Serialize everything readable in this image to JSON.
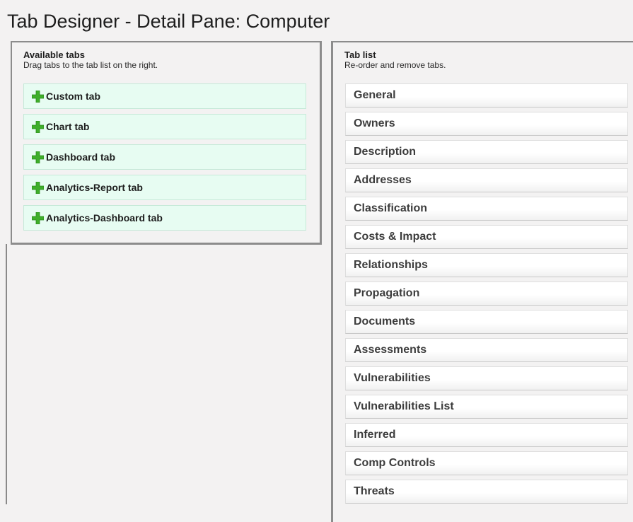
{
  "page": {
    "title": "Tab Designer - Detail Pane: Computer"
  },
  "available_tabs": {
    "heading": "Available tabs",
    "description": "Drag tabs to the tab list on the right.",
    "add_icon": "plus-icon",
    "add_icon_color": "#3fae2a",
    "items": [
      {
        "label": "Custom tab"
      },
      {
        "label": "Chart tab"
      },
      {
        "label": "Dashboard tab"
      },
      {
        "label": "Analytics-Report tab"
      },
      {
        "label": "Analytics-Dashboard tab"
      }
    ]
  },
  "tab_list": {
    "heading": "Tab list",
    "description": "Re-order and remove tabs.",
    "items": [
      {
        "label": "General"
      },
      {
        "label": "Owners"
      },
      {
        "label": "Description"
      },
      {
        "label": "Addresses"
      },
      {
        "label": "Classification"
      },
      {
        "label": "Costs & Impact"
      },
      {
        "label": "Relationships"
      },
      {
        "label": "Propagation"
      },
      {
        "label": "Documents"
      },
      {
        "label": "Assessments"
      },
      {
        "label": "Vulnerabilities"
      },
      {
        "label": "Vulnerabilities List"
      },
      {
        "label": "Inferred"
      },
      {
        "label": "Comp Controls"
      },
      {
        "label": "Threats"
      }
    ]
  }
}
